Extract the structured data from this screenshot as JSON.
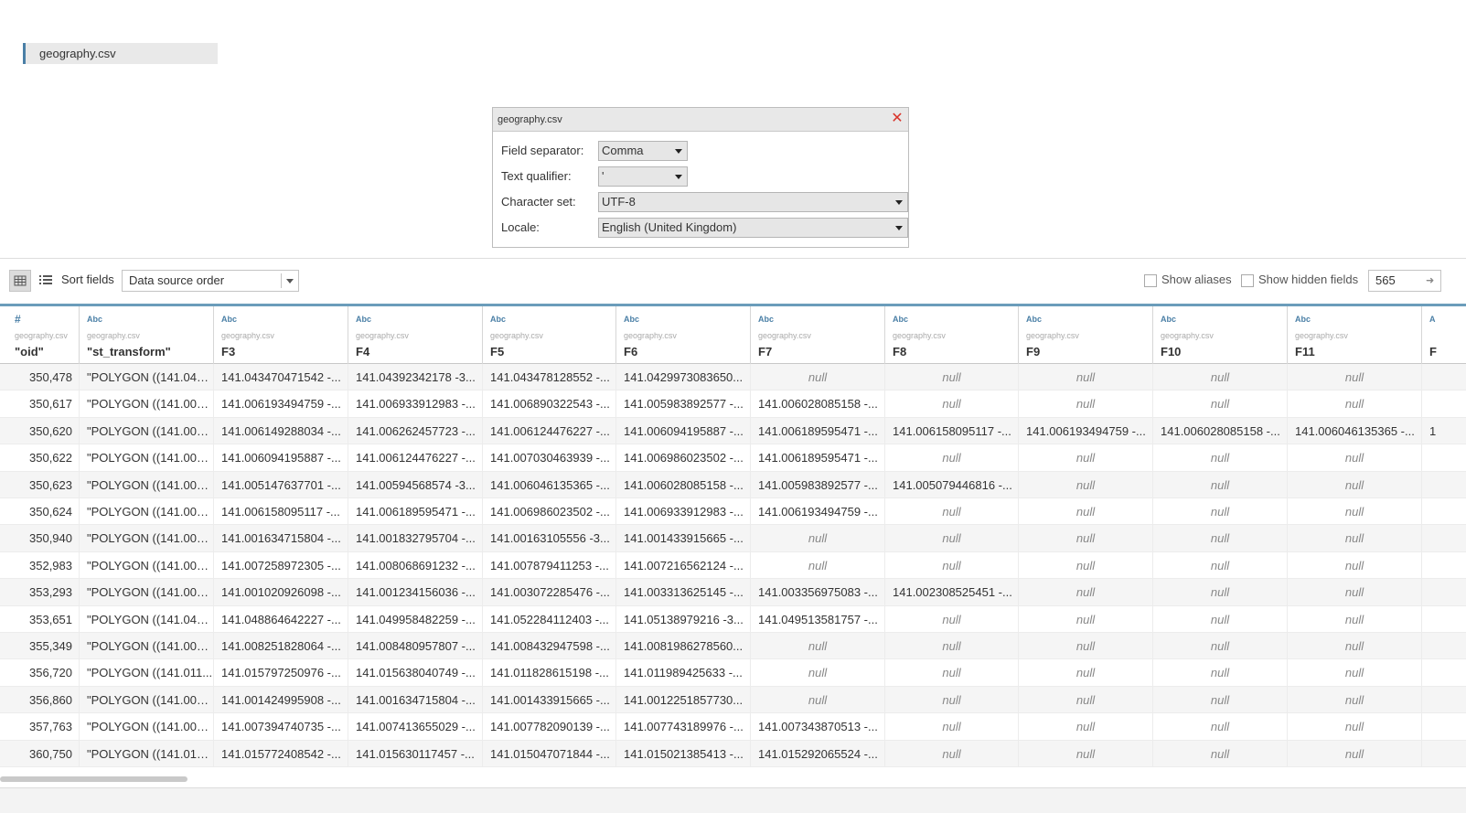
{
  "connection": {
    "label": "geography.csv"
  },
  "dialog": {
    "title": "geography.csv",
    "close_label": "✕",
    "fields": [
      {
        "label": "Field separator:",
        "value": "Comma"
      },
      {
        "label": "Text qualifier:",
        "value": "'"
      },
      {
        "label": "Character set:",
        "value": "UTF-8"
      },
      {
        "label": "Locale:",
        "value": "English (United Kingdom)"
      }
    ]
  },
  "toolbar": {
    "sort_label": "Sort fields",
    "sort_value": "Data source order",
    "show_aliases": "Show aliases",
    "show_hidden": "Show hidden fields",
    "rows_value": "565"
  },
  "columns": [
    {
      "type": "#",
      "source": "geography.csv",
      "name": "\"oid\""
    },
    {
      "type": "Abc",
      "source": "geography.csv",
      "name": "\"st_transform\""
    },
    {
      "type": "Abc",
      "source": "geography.csv",
      "name": "F3"
    },
    {
      "type": "Abc",
      "source": "geography.csv",
      "name": "F4"
    },
    {
      "type": "Abc",
      "source": "geography.csv",
      "name": "F5"
    },
    {
      "type": "Abc",
      "source": "geography.csv",
      "name": "F6"
    },
    {
      "type": "Abc",
      "source": "geography.csv",
      "name": "F7"
    },
    {
      "type": "Abc",
      "source": "geography.csv",
      "name": "F8"
    },
    {
      "type": "Abc",
      "source": "geography.csv",
      "name": "F9"
    },
    {
      "type": "Abc",
      "source": "geography.csv",
      "name": "F10"
    },
    {
      "type": "Abc",
      "source": "geography.csv",
      "name": "F11"
    },
    {
      "type": "A",
      "source": "",
      "name": "F"
    }
  ],
  "rows": [
    [
      "350,478",
      "\"POLYGON ((141.042...",
      "141.043470471542 -...",
      "141.04392342178 -3...",
      "141.043478128552 -...",
      "141.0429973083650...",
      "null",
      "null",
      "null",
      "null",
      "null",
      ""
    ],
    [
      "350,617",
      "\"POLYGON ((141.006...",
      "141.006193494759 -...",
      "141.006933912983 -...",
      "141.006890322543 -...",
      "141.005983892577 -...",
      "141.006028085158 -...",
      "null",
      "null",
      "null",
      "null",
      ""
    ],
    [
      "350,620",
      "\"POLYGON ((141.005...",
      "141.006149288034 -...",
      "141.006262457723 -...",
      "141.006124476227 -...",
      "141.006094195887 -...",
      "141.006189595471 -...",
      "141.006158095117 -...",
      "141.006193494759 -...",
      "141.006028085158 -...",
      "141.006046135365 -...",
      "1"
    ],
    [
      "350,622",
      "\"POLYGON ((141.006...",
      "141.006094195887 -...",
      "141.006124476227 -...",
      "141.007030463939 -...",
      "141.006986023502 -...",
      "141.006189595471 -...",
      "null",
      "null",
      "null",
      "null",
      ""
    ],
    [
      "350,623",
      "\"POLYGON ((141.005...",
      "141.005147637701 -...",
      "141.00594568574 -3...",
      "141.006046135365 -...",
      "141.006028085158 -...",
      "141.005983892577 -...",
      "141.005079446816 -...",
      "null",
      "null",
      "null",
      ""
    ],
    [
      "350,624",
      "\"POLYGON ((141.006...",
      "141.006158095117 -...",
      "141.006189595471 -...",
      "141.006986023502 -...",
      "141.006933912983 -...",
      "141.006193494759 -...",
      "null",
      "null",
      "null",
      "null",
      ""
    ],
    [
      "350,940",
      "\"POLYGON ((141.001...",
      "141.001634715804 -...",
      "141.001832795704 -...",
      "141.00163105556 -3...",
      "141.001433915665 -...",
      "null",
      "null",
      "null",
      "null",
      "null",
      ""
    ],
    [
      "352,983",
      "\"POLYGON ((141.007...",
      "141.007258972305 -...",
      "141.008068691232 -...",
      "141.007879411253 -...",
      "141.007216562124 -...",
      "null",
      "null",
      "null",
      "null",
      "null",
      ""
    ],
    [
      "353,293",
      "\"POLYGON ((141.002...",
      "141.001020926098 -...",
      "141.001234156036 -...",
      "141.003072285476 -...",
      "141.003313625145 -...",
      "141.003356975083 -...",
      "141.002308525451 -...",
      "null",
      "null",
      "null",
      ""
    ],
    [
      "353,651",
      "\"POLYGON ((141.049...",
      "141.048864642227 -...",
      "141.049958482259 -...",
      "141.052284112403 -...",
      "141.05138979216 -3...",
      "141.049513581757 -...",
      "null",
      "null",
      "null",
      "null",
      ""
    ],
    [
      "355,349",
      "\"POLYGON ((141.008...",
      "141.008251828064 -...",
      "141.008480957807 -...",
      "141.008432947598 -...",
      "141.0081986278560...",
      "null",
      "null",
      "null",
      "null",
      "null",
      ""
    ],
    [
      "356,720",
      "\"POLYGON ((141.011...",
      "141.015797250976 -...",
      "141.015638040749 -...",
      "141.011828615198 -...",
      "141.011989425633 -...",
      "null",
      "null",
      "null",
      "null",
      "null",
      ""
    ],
    [
      "356,860",
      "\"POLYGON ((141.001...",
      "141.001424995908 -...",
      "141.001634715804 -...",
      "141.001433915665 -...",
      "141.0012251857730...",
      "null",
      "null",
      "null",
      "null",
      "null",
      ""
    ],
    [
      "357,763",
      "\"POLYGON ((141.007...",
      "141.007394740735 -...",
      "141.007413655029 -...",
      "141.007782090139 -...",
      "141.007743189976 -...",
      "141.007343870513 -...",
      "null",
      "null",
      "null",
      "null",
      ""
    ],
    [
      "360,750",
      "\"POLYGON ((141.015...",
      "141.015772408542 -...",
      "141.015630117457 -...",
      "141.015047071844 -...",
      "141.015021385413 -...",
      "141.015292065524 -...",
      "null",
      "null",
      "null",
      "null",
      ""
    ]
  ]
}
